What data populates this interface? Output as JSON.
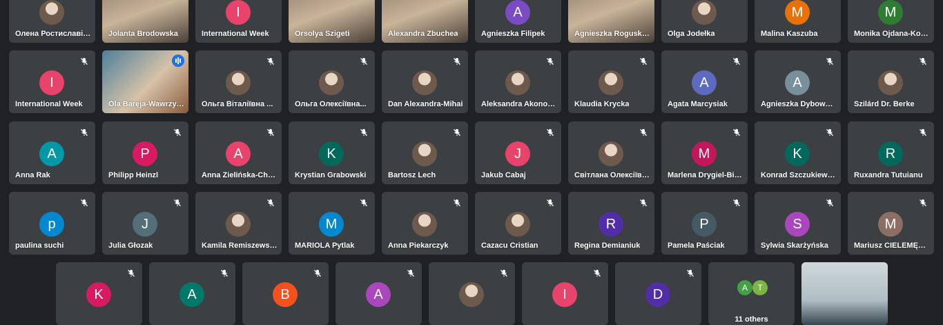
{
  "rows": [
    [
      {
        "name": "Олена Ростиславівна",
        "type": "photo"
      },
      {
        "name": "Jolanta Brodowska",
        "type": "video"
      },
      {
        "name": "International Week",
        "type": "avatar",
        "initial": "I",
        "color": "#e8436b"
      },
      {
        "name": "Orsolya Szigeti",
        "type": "video"
      },
      {
        "name": "Alexandra Zbuchea",
        "type": "video"
      },
      {
        "name": "Agnieszka Filipek",
        "type": "avatar",
        "initial": "A",
        "color": "#7b4bc4"
      },
      {
        "name": "Agnieszka Rogusk…",
        "type": "video"
      },
      {
        "name": "Olga Jodełka",
        "type": "photo"
      },
      {
        "name": "Malina Kaszuba",
        "type": "avatar",
        "initial": "M",
        "color": "#e8710a"
      },
      {
        "name": "Monika Ojdana-Kościuszko",
        "type": "avatar",
        "initial": "M",
        "color": "#2e7d32"
      }
    ],
    [
      {
        "name": "International Week",
        "type": "avatar",
        "initial": "I",
        "color": "#e8436b"
      },
      {
        "name": "Ola Baręja-Wawrzyniak",
        "type": "video",
        "active": true
      },
      {
        "name": "Ольга Віталіївна ...",
        "type": "photo"
      },
      {
        "name": "Ольга Олексіївна...",
        "type": "photo"
      },
      {
        "name": "Dan Alexandra-Mihai",
        "type": "photo"
      },
      {
        "name": "Aleksandra Akonom…",
        "type": "photo"
      },
      {
        "name": "Klaudia Krycka",
        "type": "photo"
      },
      {
        "name": "Agata Marcysiak",
        "type": "avatar",
        "initial": "A",
        "color": "#5c6bc0"
      },
      {
        "name": "Agnieszka Dybowska",
        "type": "avatar",
        "initial": "A",
        "color": "#78909c"
      },
      {
        "name": "Szilárd Dr. Berke",
        "type": "photo"
      }
    ],
    [
      {
        "name": "Anna Rak",
        "type": "avatar",
        "initial": "A",
        "color": "#0097a7"
      },
      {
        "name": "Philipp Heinzl",
        "type": "avatar",
        "initial": "P",
        "color": "#d81b60"
      },
      {
        "name": "Anna Zielińska-Chmielewska",
        "type": "avatar",
        "initial": "A",
        "color": "#e8436b"
      },
      {
        "name": "Krystian Grabowski",
        "type": "avatar",
        "initial": "K",
        "color": "#00695c"
      },
      {
        "name": "Bartosz Lech",
        "type": "photo"
      },
      {
        "name": "Jakub Cabaj",
        "type": "avatar",
        "initial": "J",
        "color": "#e8436b"
      },
      {
        "name": "Світлана Олексіївна",
        "type": "photo"
      },
      {
        "name": "Marlena Drygiel-Bielińska",
        "type": "avatar",
        "initial": "M",
        "color": "#c2185b"
      },
      {
        "name": "Konrad Szczukiewicz",
        "type": "avatar",
        "initial": "K",
        "color": "#00695c"
      },
      {
        "name": "Ruxandra Tutuianu",
        "type": "avatar",
        "initial": "R",
        "color": "#00695c"
      }
    ],
    [
      {
        "name": "paulina suchi",
        "type": "avatar",
        "initial": "p",
        "color": "#0288d1"
      },
      {
        "name": "Julia Głozak",
        "type": "avatar",
        "initial": "J",
        "color": "#546e7a"
      },
      {
        "name": "Kamila Remiszewska",
        "type": "photo"
      },
      {
        "name": "MARIOLA Pytlak",
        "type": "avatar",
        "initial": "M",
        "color": "#0288d1"
      },
      {
        "name": "Anna Piekarczyk",
        "type": "photo"
      },
      {
        "name": "Cazacu Cristian",
        "type": "photo"
      },
      {
        "name": "Regina Demianiuk",
        "type": "avatar",
        "initial": "R",
        "color": "#512da8"
      },
      {
        "name": "Pamela Paściak",
        "type": "avatar",
        "initial": "P",
        "color": "#455a64"
      },
      {
        "name": "Sylwia Skarżyńska",
        "type": "avatar",
        "initial": "S",
        "color": "#ab47bc"
      },
      {
        "name": "Mariusz CIELEMĘCKI",
        "type": "avatar",
        "initial": "M",
        "color": "#8d6e63"
      }
    ],
    [
      {
        "name": "",
        "type": "avatar",
        "initial": "K",
        "color": "#d81b60"
      },
      {
        "name": "",
        "type": "avatar",
        "initial": "A",
        "color": "#00796b"
      },
      {
        "name": "",
        "type": "avatar",
        "initial": "B",
        "color": "#f4511e"
      },
      {
        "name": "",
        "type": "avatar",
        "initial": "A",
        "color": "#ab47bc"
      },
      {
        "name": "",
        "type": "photo"
      },
      {
        "name": "",
        "type": "avatar",
        "initial": "I",
        "color": "#e8436b"
      },
      {
        "name": "",
        "type": "avatar",
        "initial": "D",
        "color": "#512da8"
      },
      {
        "name": "",
        "type": "others",
        "label": "11 others",
        "mini": [
          {
            "initial": "A",
            "color": "#43a047"
          },
          {
            "initial": "T",
            "color": "#7cb342"
          }
        ]
      },
      {
        "name": "",
        "type": "video",
        "self": true
      }
    ]
  ]
}
